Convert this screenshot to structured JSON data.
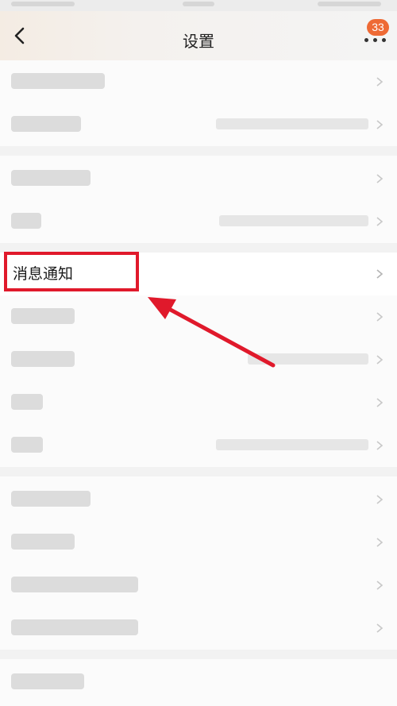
{
  "header": {
    "title": "设置",
    "badge_count": "33",
    "back_icon": "chevron-left-icon",
    "more_icon": "more-dots-icon"
  },
  "highlighted_item": {
    "label": "消息通知"
  },
  "colors": {
    "highlight": "#e0192b",
    "badge": "#ee6a35"
  }
}
